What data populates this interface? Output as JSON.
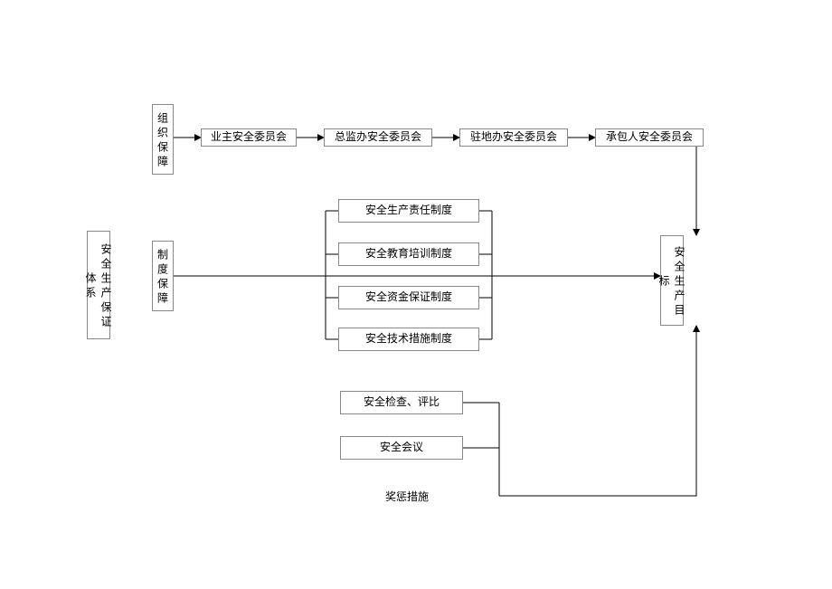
{
  "root_label": "安全生产保证体系",
  "branch1_label": "组织保障",
  "branch2_label": "制度保障",
  "org": {
    "n1": "业主安全委员会",
    "n2": "总监办安全委员会",
    "n3": "驻地办安全委员会",
    "n4": "承包人安全委员会"
  },
  "inst": {
    "i1": "安全生产责任制度",
    "i2": "安全教育培训制度",
    "i3": "安全资金保证制度",
    "i4": "安全技术措施制度"
  },
  "measures": {
    "m1": "安全检查、评比",
    "m2": "安全会议",
    "m3": "奖惩措施"
  },
  "goal_label": "安全生产目标"
}
